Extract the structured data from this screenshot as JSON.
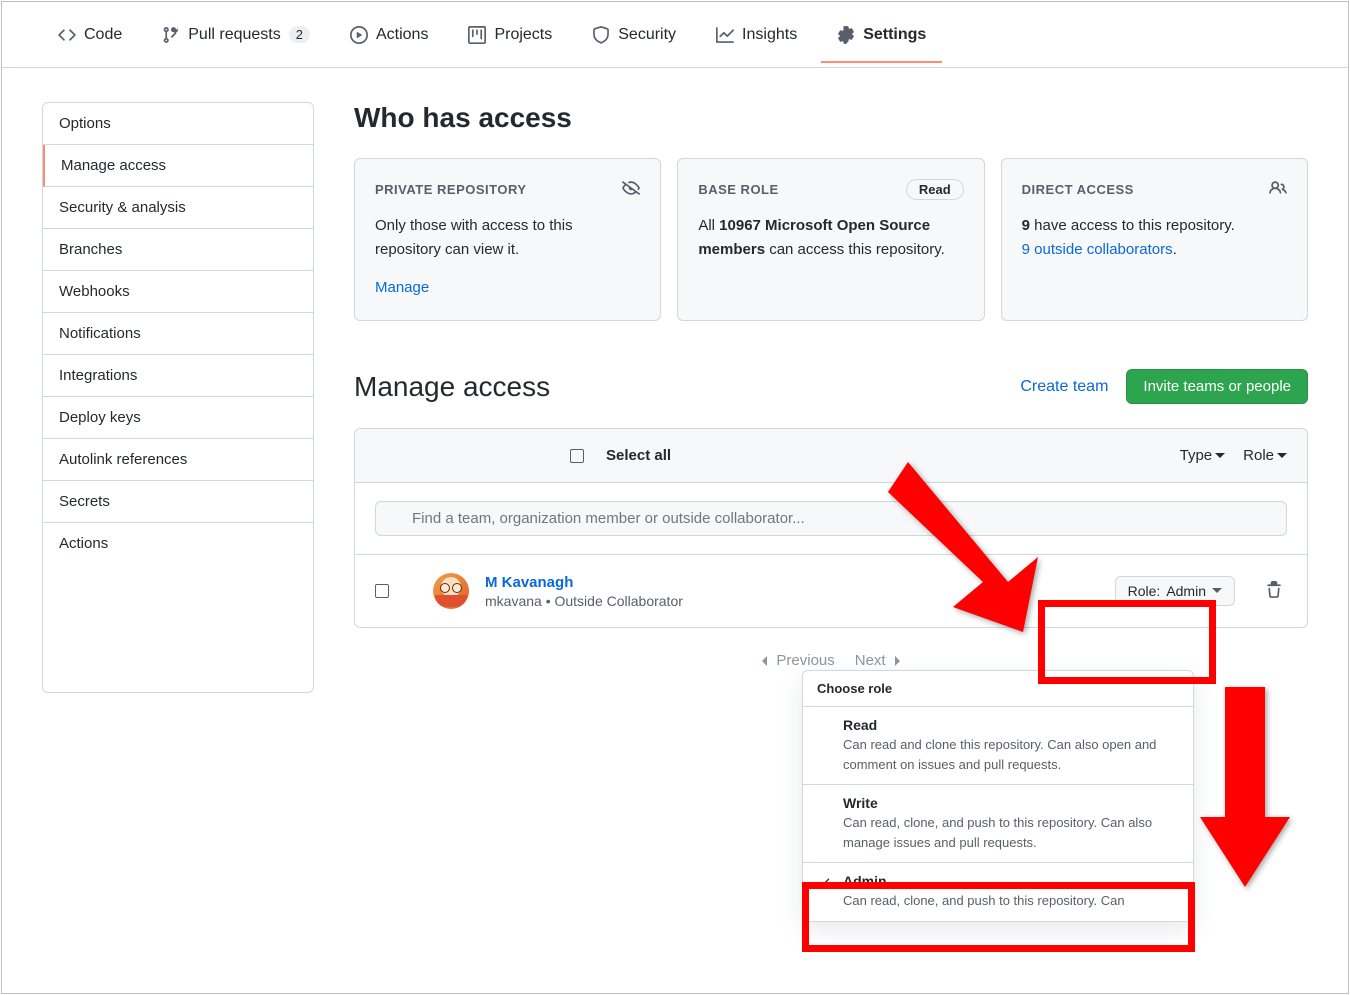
{
  "nav": {
    "code": "Code",
    "pull_requests": "Pull requests",
    "pr_count": "2",
    "actions": "Actions",
    "projects": "Projects",
    "security": "Security",
    "insights": "Insights",
    "settings": "Settings"
  },
  "sidebar": {
    "items": [
      "Options",
      "Manage access",
      "Security & analysis",
      "Branches",
      "Webhooks",
      "Notifications",
      "Integrations",
      "Deploy keys",
      "Autolink references",
      "Secrets",
      "Actions"
    ]
  },
  "who_heading": "Who has access",
  "card1": {
    "title": "PRIVATE REPOSITORY",
    "body": "Only those with access to this repository can view it.",
    "manage": "Manage"
  },
  "card2": {
    "title": "BASE ROLE",
    "badge": "Read",
    "body_prefix": "All ",
    "body_bold": "10967 Microsoft Open Source members",
    "body_suffix": " can access this repository."
  },
  "card3": {
    "title": "DIRECT ACCESS",
    "line1_bold": "9",
    "line1_rest": " have access to this repository.",
    "line2": "9 outside collaborators",
    "line2_suffix": "."
  },
  "manage_heading": "Manage access",
  "create_team": "Create team",
  "invite_btn": "Invite teams or people",
  "select_all": "Select all",
  "type_drop": "Type",
  "role_drop": "Role",
  "search_placeholder": "Find a team, organization member or outside collaborator...",
  "user": {
    "name": "M Kavanagh",
    "meta": "mkavana • Outside Collaborator",
    "role_label": "Role: ",
    "role_value": "Admin"
  },
  "pagination": {
    "prev": "Previous",
    "next": "Next"
  },
  "menu": {
    "title": "Choose role",
    "read_t": "Read",
    "read_d": "Can read and clone this repository. Can also open and comment on issues and pull requests.",
    "write_t": "Write",
    "write_d": "Can read, clone, and push to this repository. Can also manage issues and pull requests.",
    "admin_t": "Admin",
    "admin_d": "Can read, clone, and push to this repository. Can"
  }
}
